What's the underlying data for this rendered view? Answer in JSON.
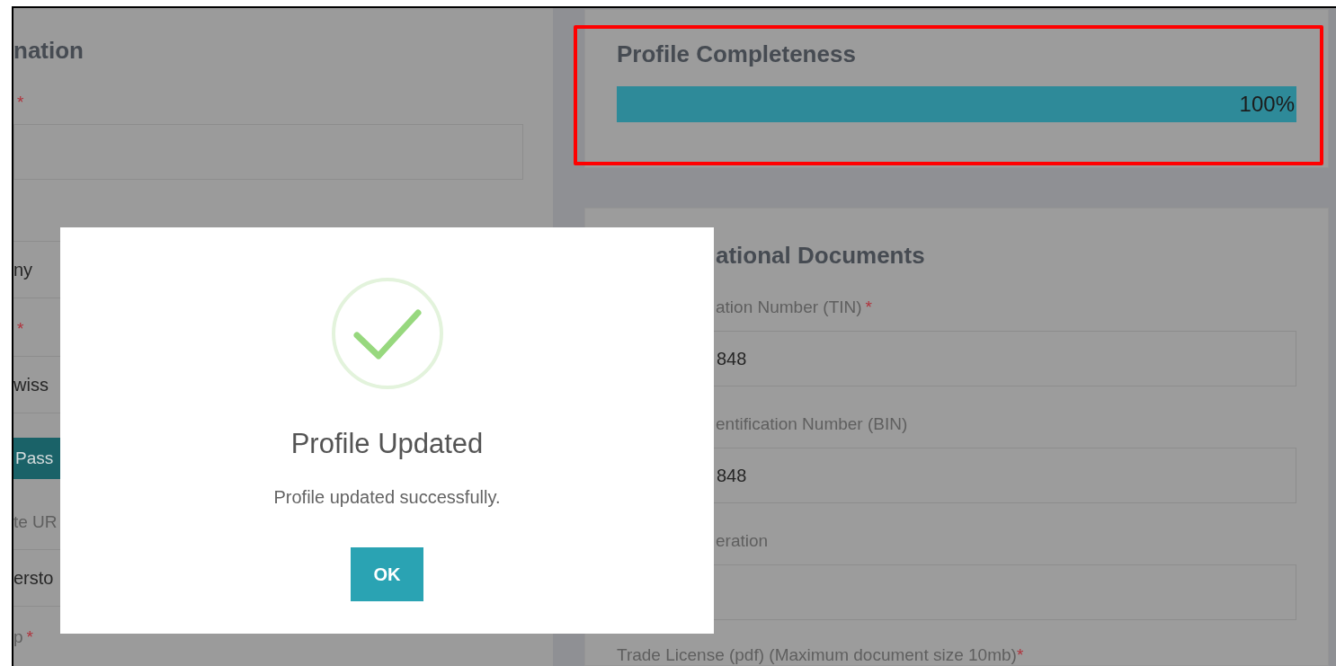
{
  "left_panel": {
    "heading": "nation",
    "items": [
      {
        "kind": "label",
        "mark": "*"
      },
      {
        "kind": "input"
      },
      {
        "kind": "row",
        "text": "ny"
      },
      {
        "kind": "label",
        "mark": "*"
      },
      {
        "kind": "row",
        "text": "wiss"
      },
      {
        "kind": "button",
        "text": "Pass"
      },
      {
        "kind": "label",
        "text": "te UR"
      },
      {
        "kind": "row",
        "text": "ersto"
      },
      {
        "kind": "label",
        "text": "p",
        "mark": "*"
      }
    ]
  },
  "profile_completeness": {
    "title": "Profile Completeness",
    "level": 1,
    "reading": "100%"
  },
  "documents": {
    "heading": "ational Documents",
    "fields": [
      {
        "label": "ation Number (TIN)",
        "mark": "*",
        "value": "848"
      },
      {
        "label": "entification Number (BIN)",
        "value": "848"
      },
      {
        "label": "eration"
      }
    ],
    "note": {
      "text": "Trade License (pdf) (Maximum document size 10mb)",
      "mark": "*"
    }
  },
  "dialog": {
    "title": "Profile Updated",
    "message": "Profile updated successfully.",
    "button": "OK"
  }
}
